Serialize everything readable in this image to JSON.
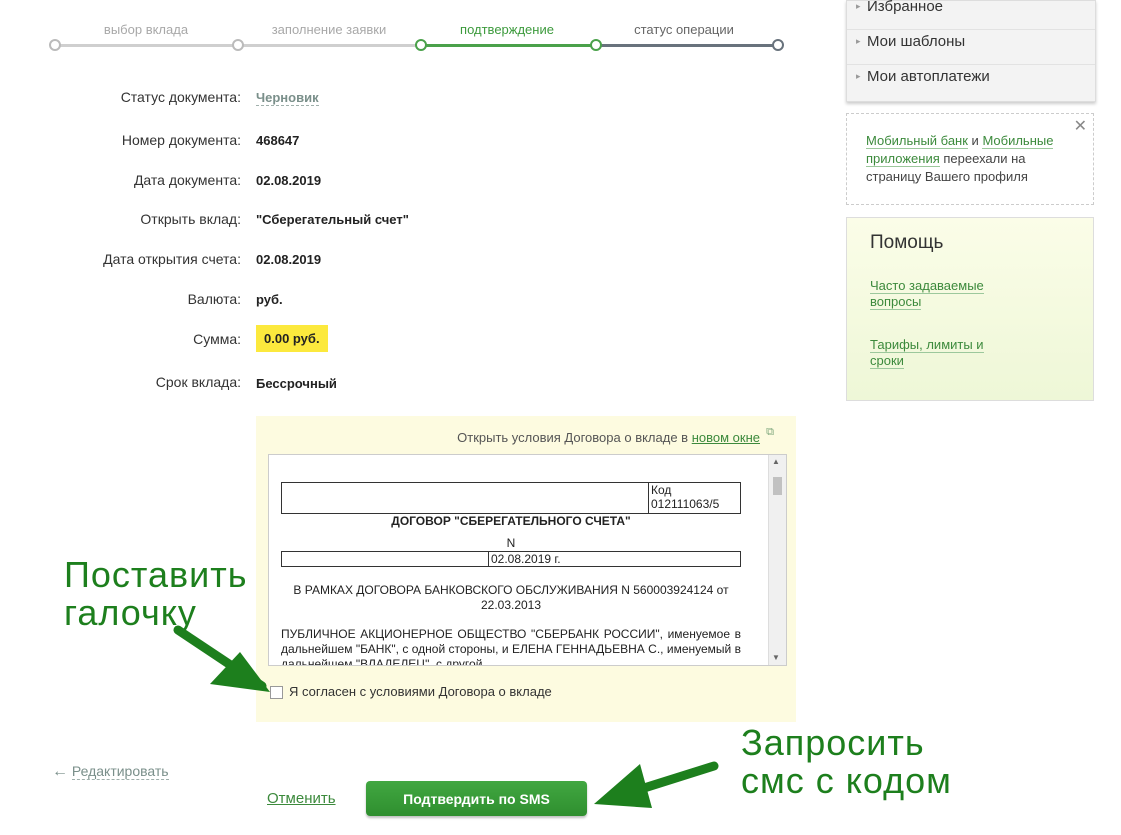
{
  "steps": [
    {
      "label": "выбор вклада"
    },
    {
      "label": "заполнение заявки"
    },
    {
      "label": "подтверждение"
    },
    {
      "label": "статус операции"
    }
  ],
  "form": {
    "status_label": "Статус документа:",
    "status_value": "Черновик",
    "number_label": "Номер документа:",
    "number_value": "468647",
    "date_label": "Дата документа:",
    "date_value": "02.08.2019",
    "deposit_label": "Открыть вклад:",
    "deposit_value": "\"Сберегательный счет\"",
    "open_date_label": "Дата открытия счета:",
    "open_date_value": "02.08.2019",
    "currency_label": "Валюта:",
    "currency_value": "руб.",
    "sum_label": "Сумма:",
    "sum_value": "0.00 руб.",
    "term_label": "Срок вклада:",
    "term_value": "Бессрочный"
  },
  "contract": {
    "open_text": "Открыть условия Договора о вкладе в",
    "open_link": "новом окне",
    "doc_code": "Код 012111063/5",
    "doc_title": "ДОГОВОР \"СБЕРЕГАТЕЛЬНОГО СЧЕТА\"",
    "doc_n": "N",
    "doc_date": "02.08.2019 г.",
    "doc_framework": "В РАМКАХ ДОГОВОРА БАНКОВСКОГО ОБСЛУЖИВАНИЯ N 560003924124 от 22.03.2013",
    "doc_body": "ПУБЛИЧНОЕ АКЦИОНЕРНОЕ ОБЩЕСТВО \"СБЕРБАНК РОССИИ\", именуемое в дальнейшем \"БАНК\", с одной стороны, и ЕЛЕНА ГЕННАДЬЕВНА С., именуемый в дальнейшем \"ВЛАДЕЛЕЦ\", с другой",
    "agree_label": "Я согласен с условиями Договора о вкладе",
    "agree_checked": false
  },
  "actions": {
    "edit_label": "Редактировать",
    "cancel_label": "Отменить",
    "confirm_label": "Подтвердить по SMS"
  },
  "sidebar": {
    "menu": [
      {
        "label": "Избранное"
      },
      {
        "label": "Мои шаблоны"
      },
      {
        "label": "Мои автоплатежи"
      }
    ],
    "notice": {
      "link1": "Мобильный банк",
      "and": "и",
      "link2": "Мобильные приложения",
      "text": "переехали на страницу Вашего профиля"
    },
    "help": {
      "title": "Помощь",
      "faq": "Часто задаваемые вопросы",
      "tariffs": "Тарифы, лимиты и сроки"
    }
  },
  "annotations": {
    "checkbox_hint": "Поставить\nгалочку",
    "sms_hint": "Запросить\nсмс с кодом"
  },
  "colors": {
    "accent_green": "#3c9a3c",
    "button_green": "#2f8f2f",
    "sum_highlight": "#fce93d",
    "annotation_green": "#1d7f1d"
  }
}
